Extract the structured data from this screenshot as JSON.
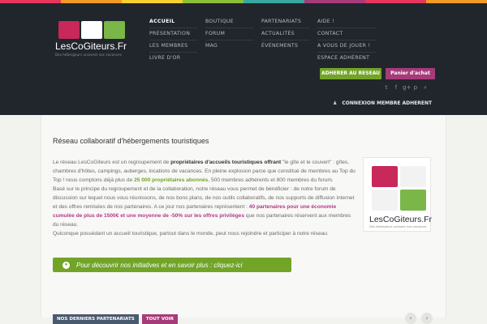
{
  "stripe_colors": [
    "#e8355e",
    "#f29b25",
    "#f6d22e",
    "#8bbf3a",
    "#3aa7a0",
    "#a63b7a",
    "#e8355e",
    "#f29b25"
  ],
  "brand": {
    "name": "LesCoGiteurs.Fr",
    "tagline": "Des hébergeurs unissent nos vacances",
    "icon_colors": [
      "#c8285a",
      "#ffffff",
      "#7ab648"
    ]
  },
  "nav": {
    "col1": [
      "ACCUEIL",
      "PRÉSENTATION",
      "LES MEMBRES",
      "LIVRE D'OR"
    ],
    "col2": [
      "BOUTIQUE",
      "FORUM",
      "MAG"
    ],
    "col3": [
      "PARTENARIATS",
      "ACTUALITÉS",
      "ÉVÉNEMENTS"
    ],
    "col4": [
      "AIDE !",
      "CONTACT",
      "A VOUS DE JOUER !",
      "ESPACE ADHÉRENT"
    ]
  },
  "buttons": {
    "join": "ADHERER AU RESEAU",
    "cart": "Panier d'achat"
  },
  "social_icons": [
    "twitter-icon",
    "facebook-icon",
    "google-plus-icon",
    "pinterest-icon",
    "search-icon"
  ],
  "social_glyphs": [
    "𝕥",
    "f",
    "g+",
    "p",
    "⌕"
  ],
  "login": {
    "label": "CONNEXION MEMBRE ADHERENT",
    "icon": "user-icon"
  },
  "main": {
    "title": "Réseau collaboratif d'hébergements touristiques",
    "p1_a": "Le réseau LesCoGiteurs est un regroupement de ",
    "p1_b": "propriétaires d'accueils touristiques offrant",
    "p1_c": " \"le gîte et le couvert\" : gîtes, chambres d'hôtes, campings, auberges, locations de vacances. En pleine explosion parce que constitué de membres au Top du Top ! nous comptons déjà plus de ",
    "p1_d": "25 000 propriétaires abonnés",
    "p1_e": ", 500 membres adhérents et 800 membres du forum.",
    "p2_a": "Basé sur le principe du regroupement et de la collaboration, notre réseau vous permet de bénéficier : de notre forum de discussion sur lequel nous vous réunissons, de nos bons plans, de nos outils collaboratifs, de nos supports de diffusion internet et des offres remisées de nos partenaires. A ce jour nos partenaires représentent : ",
    "p2_b": "40 partenaires pour une économie cumulée de plus de 1500€ et une moyenne de -50% sur les offres privilèges",
    "p2_c": " que nos partenaires réservent aux membres du réseau.",
    "p3": "Quiconque possédant un accueil touristique, partout dans le monde, peut nous rejoindre et participer à notre réseau.",
    "cta": "Pour découvrir nos initiatives et en savoir plus : cliquez-ici"
  },
  "side_logo": {
    "name": "LesCoGiteurs.Fr",
    "tagline": "Des hébergeurs unissent nos vacances"
  },
  "bottom": {
    "tab1": "NOS DERNIERS PARTENARIATS",
    "tab2": "TOUT VOIR",
    "prev": "‹",
    "next": "›"
  }
}
